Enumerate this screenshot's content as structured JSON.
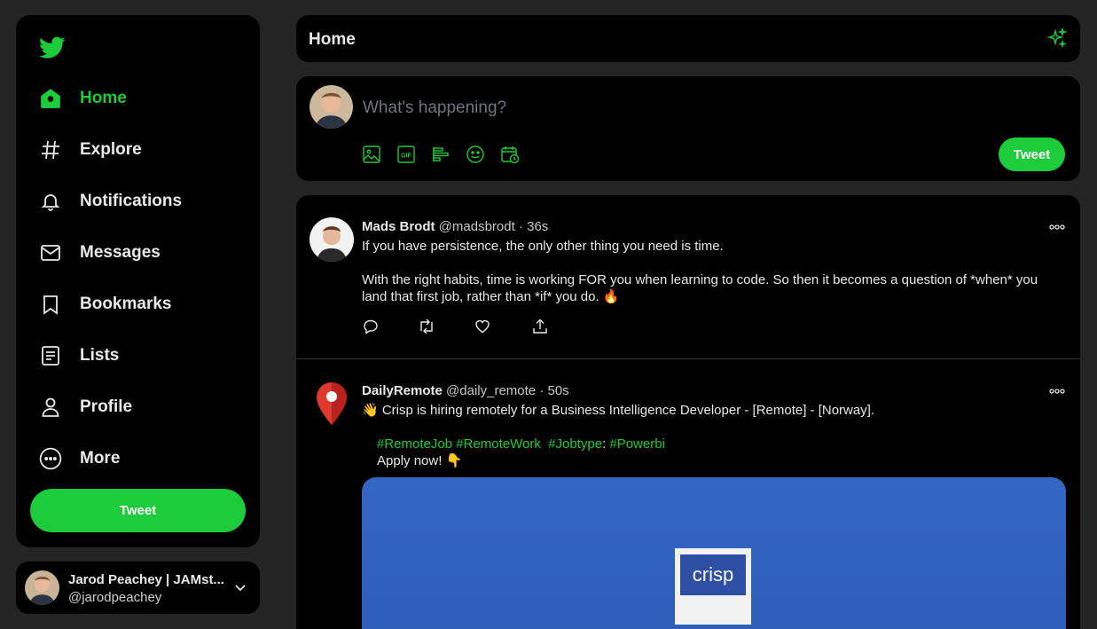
{
  "sidebar": {
    "logo_icon": "twitter-bird-icon",
    "items": [
      {
        "label": "Home",
        "icon": "home-icon",
        "active": true
      },
      {
        "label": "Explore",
        "icon": "hashtag-icon"
      },
      {
        "label": "Notifications",
        "icon": "bell-icon"
      },
      {
        "label": "Messages",
        "icon": "envelope-icon"
      },
      {
        "label": "Bookmarks",
        "icon": "bookmark-icon"
      },
      {
        "label": "Lists",
        "icon": "list-icon"
      },
      {
        "label": "Profile",
        "icon": "user-icon"
      },
      {
        "label": "More",
        "icon": "more-circle-icon"
      }
    ],
    "tweet_button": "Tweet"
  },
  "account": {
    "name": "Jarod Peachey | JAMst...",
    "handle": "@jarodpeachey"
  },
  "header": {
    "title": "Home"
  },
  "composer": {
    "placeholder": "What's happening?",
    "tools": [
      "image-icon",
      "gif-icon",
      "poll-icon",
      "emoji-icon",
      "schedule-icon"
    ],
    "tweet_button": "Tweet"
  },
  "tweets": [
    {
      "name": "Mads Brodt",
      "handle": "@madsbrodt",
      "sep": "·",
      "time": "36s",
      "line1": "If you have persistence, the only other thing you need is time.",
      "line2": "With the right habits, time is working FOR you when learning to code. So then it becomes a question of *when* you land that first job, rather than *if* you do. 🔥"
    },
    {
      "name": "DailyRemote",
      "handle": "@daily_remote",
      "sep": "·",
      "time": "50s",
      "line1": "👋 Crisp is hiring remotely for a Business Intelligence Developer - [Remote] - [Norway].",
      "hashtags": [
        "#RemoteJob",
        "#RemoteWork",
        "#Jobtype",
        ":",
        "#Powerbi"
      ],
      "line3": "Apply now! 👇",
      "media_text": "crisp"
    }
  ],
  "colors": {
    "accent": "#1ecb3b",
    "background": "#252425",
    "panel": "#000000"
  }
}
